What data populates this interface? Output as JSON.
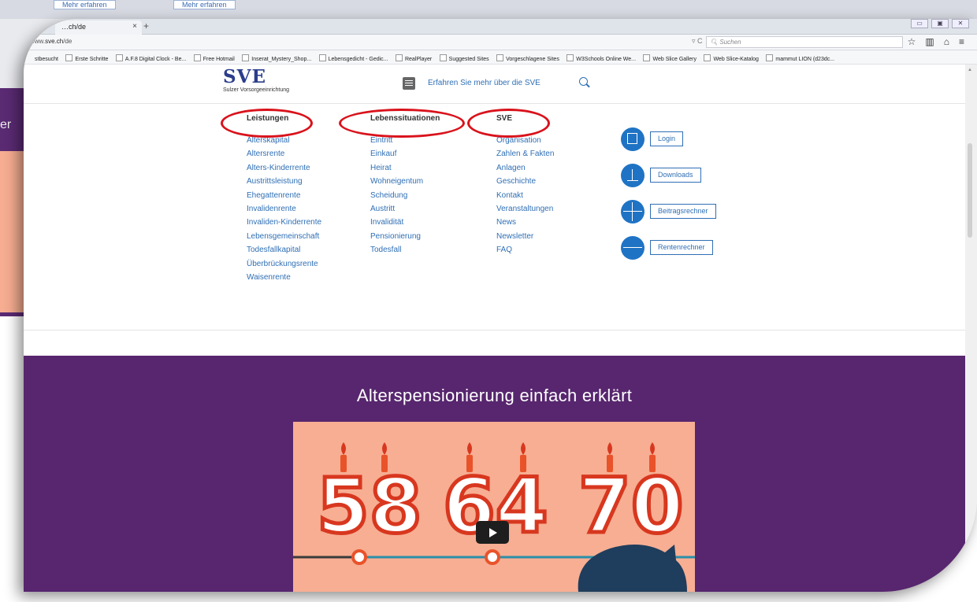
{
  "background": {
    "buttons": [
      "Mehr erfahren",
      "Mehr erfahren"
    ],
    "side_text": "er"
  },
  "browser": {
    "tab_title": "…ch/de",
    "tab_close": "×",
    "tab_new": "+",
    "url_prefix": "www.",
    "url_host": "sve.ch",
    "url_path": "/de",
    "reload": "▿ C",
    "search_placeholder": "Suchen",
    "bookmarks": [
      "stbesucht",
      "Erste Schritte",
      "A.F.8 Digital Clock - Be...",
      "Free Hotmail",
      "Inserat_Mystery_Shop...",
      "Lebensgedicht - Gedic...",
      "RealPlayer",
      "Suggested Sites",
      "Vorgeschlagene Sites",
      "W3Schools Online We...",
      "Web Slice Gallery",
      "Web Slice-Katalog",
      "mammut LION (d23dc..."
    ]
  },
  "header": {
    "logo_name": "SVE",
    "logo_subtitle": "Sulzer Vorsorgeeinrichtung",
    "menu_text": "Erfahren Sie mehr über die SVE"
  },
  "menu": {
    "columns": [
      {
        "heading": "Leistungen",
        "items": [
          "Alterskapital",
          "Altersrente",
          "Alters-Kinderrente",
          "Austrittsleistung",
          "Ehegattenrente",
          "Invalidenrente",
          "Invaliden-Kinderrente",
          "Lebensgemeinschaft",
          "Todesfallkapital",
          "Überbrückungsrente",
          "Waisenrente"
        ]
      },
      {
        "heading": "Lebenssituationen",
        "items": [
          "Eintritt",
          "Einkauf",
          "Heirat",
          "Wohneigentum",
          "Scheidung",
          "Austritt",
          "Invalidität",
          "Pensionierung",
          "Todesfall"
        ]
      },
      {
        "heading": "SVE",
        "items": [
          "Organisation",
          "Zahlen & Fakten",
          "Anlagen",
          "Geschichte",
          "Kontakt",
          "Veranstaltungen",
          "News",
          "Newsletter",
          "FAQ"
        ]
      }
    ],
    "actions": [
      "Login",
      "Downloads",
      "Beitragsrechner",
      "Rentenrechner"
    ]
  },
  "hero": {
    "title": "Alterspensionierung einfach erklärt",
    "video_numbers": [
      "58",
      "64",
      "70"
    ]
  },
  "colors": {
    "link": "#2f6fb5",
    "brand_navy": "#2b3d8c",
    "hero_purple": "#57266e",
    "highlight_red": "#d9121b",
    "video_bg": "#f7ae93"
  }
}
